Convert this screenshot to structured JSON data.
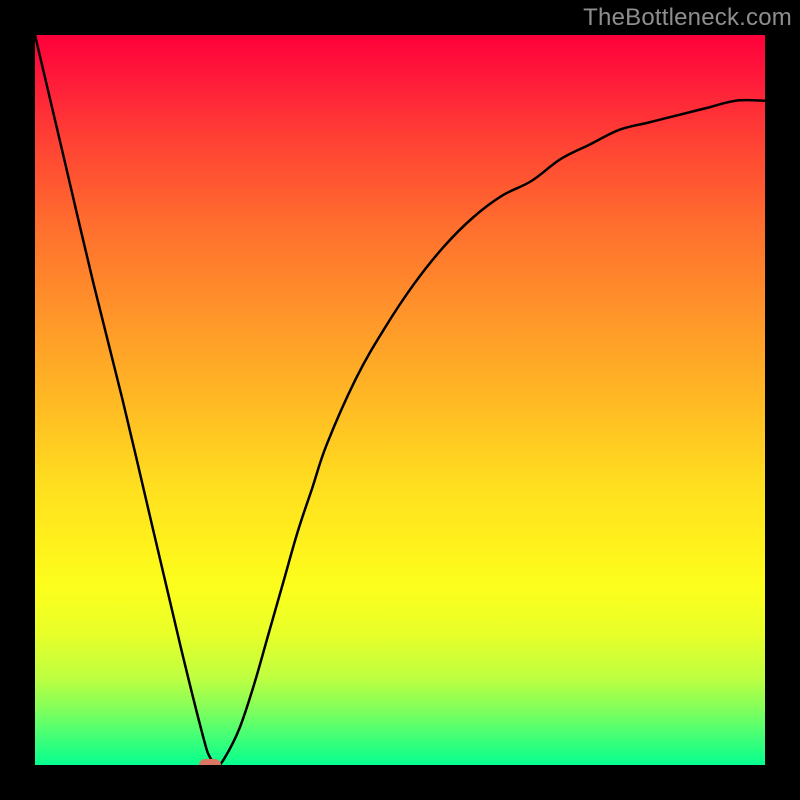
{
  "watermark": "TheBottleneck.com",
  "colors": {
    "frame": "#000000",
    "gradient_top": "#ff003a",
    "gradient_bottom": "#05ff8e",
    "curve": "#000000",
    "marker": "#d97762",
    "watermark_text": "#8e8e8e"
  },
  "chart_data": {
    "type": "line",
    "title": "",
    "xlabel": "",
    "ylabel": "",
    "xlim": [
      0,
      100
    ],
    "ylim": [
      0,
      100
    ],
    "grid": false,
    "series": [
      {
        "name": "bottleneck-curve",
        "x": [
          0,
          4,
          8,
          12,
          16,
          20,
          23,
          24,
          25,
          26,
          28,
          30,
          32,
          34,
          36,
          38,
          40,
          44,
          48,
          52,
          56,
          60,
          64,
          68,
          72,
          76,
          80,
          84,
          88,
          92,
          96,
          100
        ],
        "y": [
          100,
          83,
          66,
          50,
          33,
          16,
          4,
          1,
          0,
          1,
          5,
          11,
          18,
          25,
          32,
          38,
          44,
          53,
          60,
          66,
          71,
          75,
          78,
          80,
          83,
          85,
          87,
          88,
          89,
          90,
          91,
          91
        ]
      }
    ],
    "annotations": [
      {
        "name": "optimal-marker",
        "x": 24,
        "y": 0
      }
    ]
  }
}
